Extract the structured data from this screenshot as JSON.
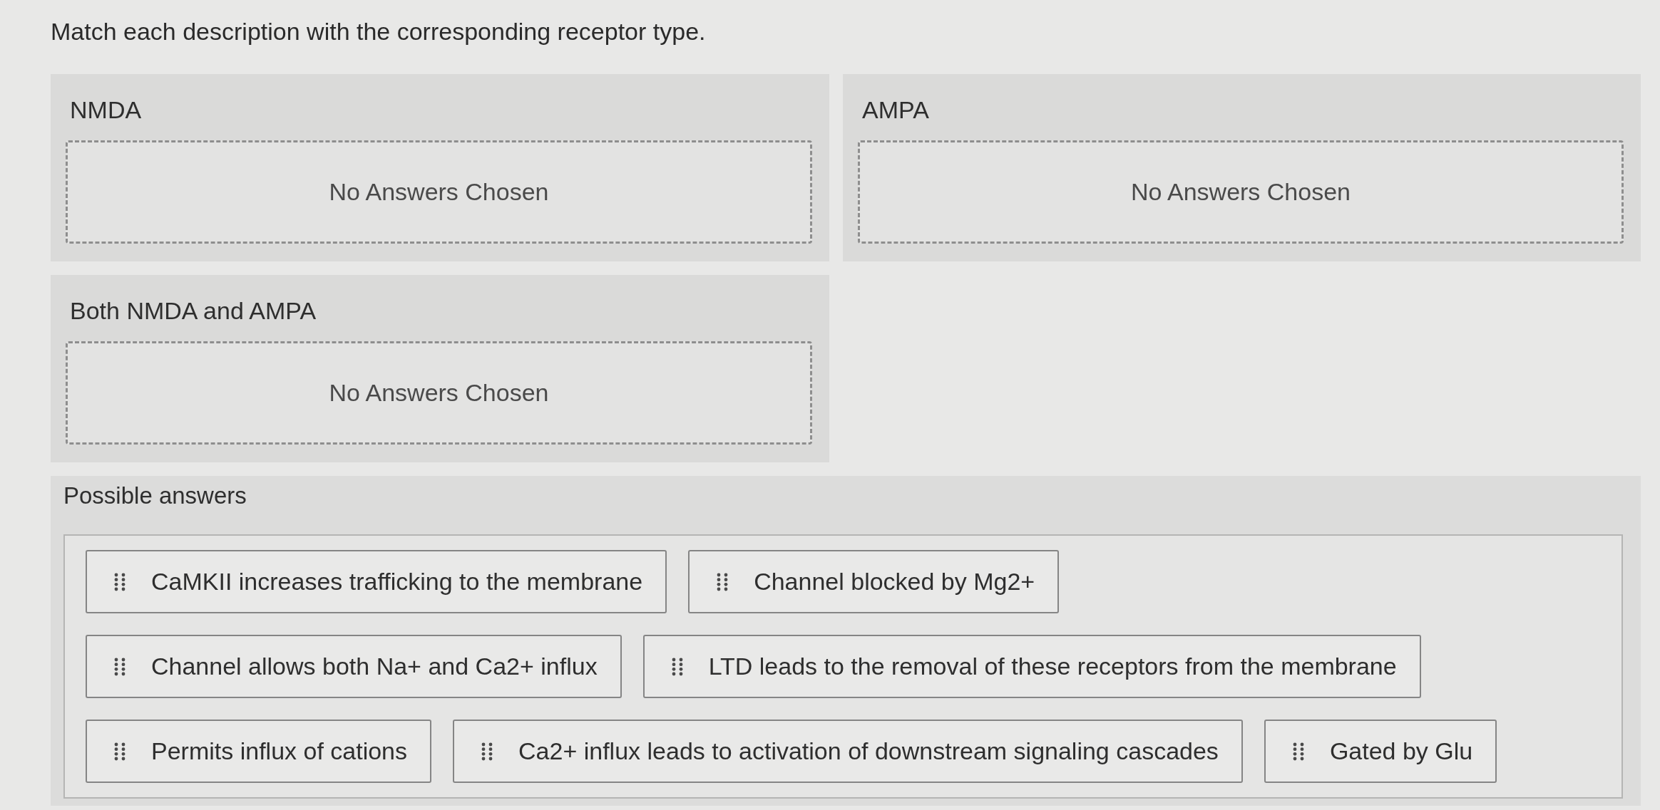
{
  "prompt": "Match each description with the corresponding receptor type.",
  "categories": [
    {
      "label": "NMDA",
      "empty_text": "No Answers Chosen"
    },
    {
      "label": "AMPA",
      "empty_text": "No Answers Chosen"
    },
    {
      "label": "Both NMDA and AMPA",
      "empty_text": "No Answers Chosen"
    }
  ],
  "possible_answers": {
    "heading": "Possible answers",
    "rows": [
      [
        "CaMKII increases trafficking to the membrane",
        "Channel blocked by Mg2+"
      ],
      [
        "Channel allows both Na+ and Ca2+ influx",
        "LTD leads to the removal of these receptors from the membrane"
      ],
      [
        "Permits influx of cations",
        "Ca2+ influx leads to activation of downstream signaling cascades",
        "Gated by Glu"
      ]
    ]
  }
}
